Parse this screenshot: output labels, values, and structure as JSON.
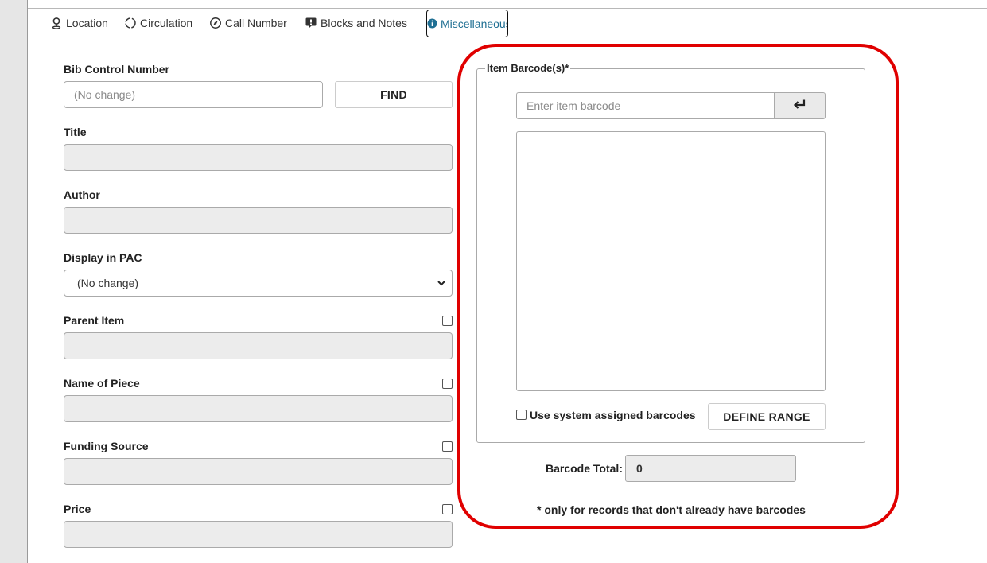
{
  "tabs": [
    {
      "label": "Location",
      "icon": "location-pin-icon"
    },
    {
      "label": "Circulation",
      "icon": "circle-dashed-icon"
    },
    {
      "label": "Call Number",
      "icon": "compass-icon"
    },
    {
      "label": "Blocks and Notes",
      "icon": "note-icon"
    },
    {
      "label": "Miscellaneous",
      "icon": "info-icon",
      "active": true
    }
  ],
  "form": {
    "bib_control_number": {
      "label": "Bib Control Number",
      "placeholder": "(No change)",
      "find_label": "FIND"
    },
    "title": {
      "label": "Title"
    },
    "author": {
      "label": "Author"
    },
    "display_in_pac": {
      "label": "Display in PAC",
      "value": "(No change)"
    },
    "parent_item": {
      "label": "Parent Item",
      "checked": false
    },
    "name_of_piece": {
      "label": "Name of Piece",
      "checked": false
    },
    "funding_source": {
      "label": "Funding Source",
      "checked": false
    },
    "price": {
      "label": "Price",
      "checked": false
    }
  },
  "barcodes": {
    "legend": "Item Barcode(s)*",
    "input_placeholder": "Enter item barcode",
    "enter_icon": "enter-arrow-icon",
    "use_system_label": "Use system assigned barcodes",
    "use_system_checked": false,
    "define_range_label": "DEFINE RANGE",
    "total_label": "Barcode Total:",
    "total_value": "0",
    "note": "* only for records that don't already have barcodes"
  },
  "colors": {
    "highlight": "#e00000",
    "active_tab": "#1f6f93",
    "readonly_bg": "#ececec"
  }
}
